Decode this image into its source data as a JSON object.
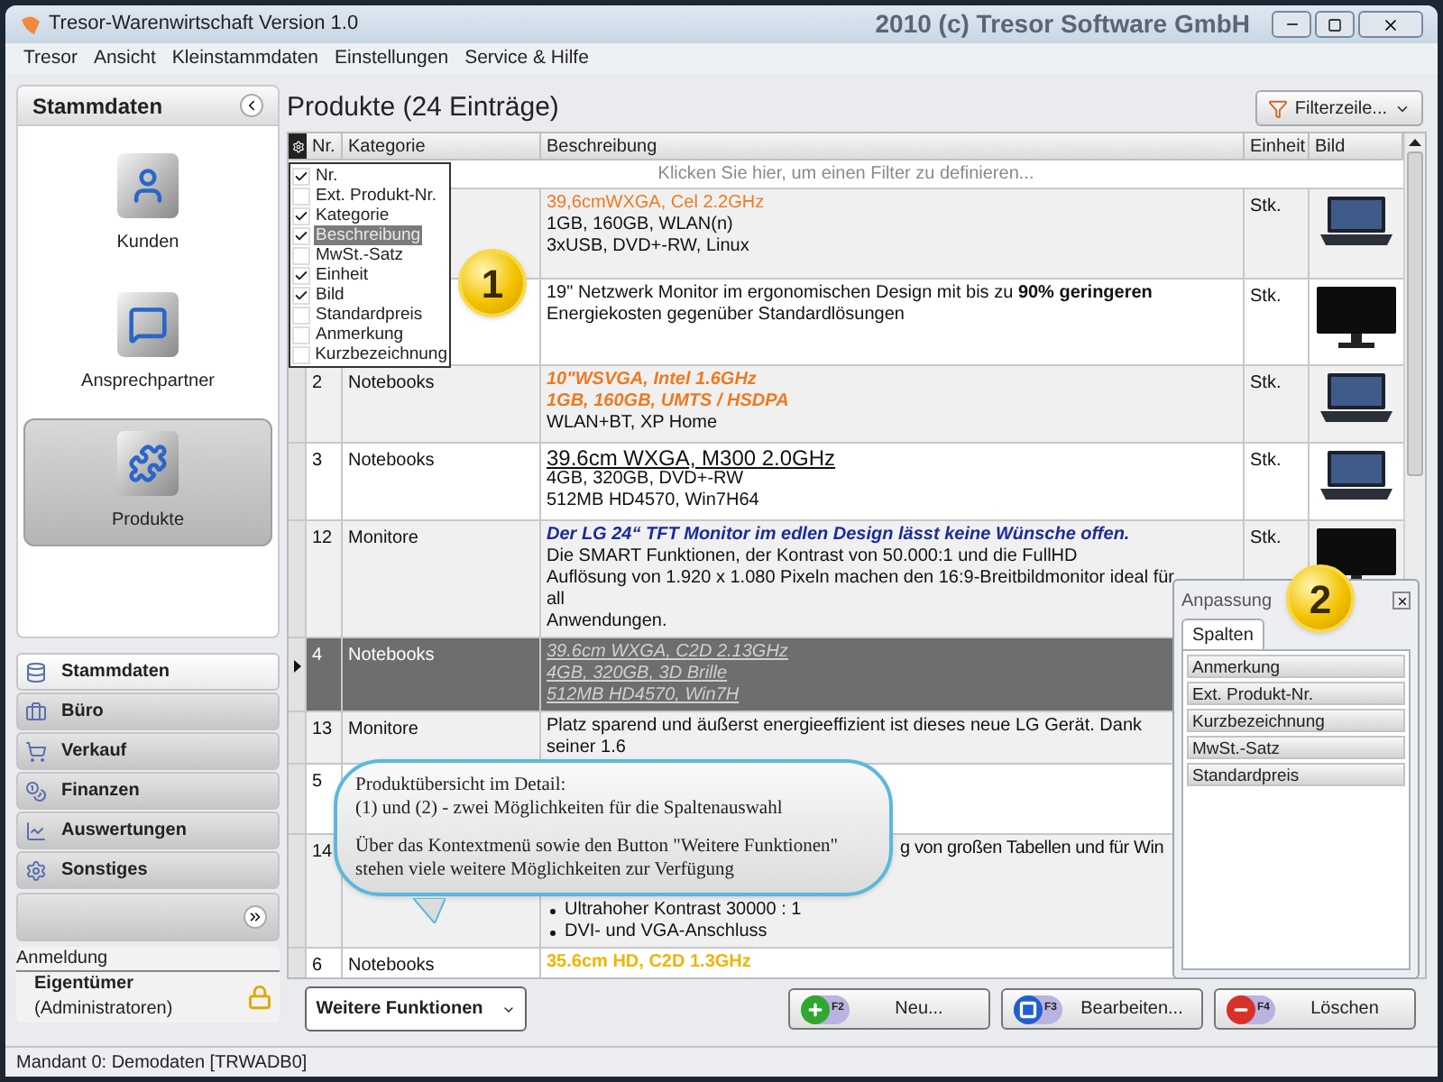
{
  "window": {
    "title": "Tresor-Warenwirtschaft Version 1.0",
    "copyright": "2010 (c) Tresor Software GmbH"
  },
  "menu": [
    "Tresor",
    "Ansicht",
    "Kleinstammdaten",
    "Einstellungen",
    "Service & Hilfe"
  ],
  "sidebar": {
    "title": "Stammdaten",
    "modules": [
      {
        "label": "Kunden",
        "selected": false
      },
      {
        "label": "Ansprechpartner",
        "selected": false
      },
      {
        "label": "Produkte",
        "selected": true
      }
    ],
    "nav": [
      {
        "label": "Stammdaten",
        "selected": true
      },
      {
        "label": "Büro",
        "selected": false
      },
      {
        "label": "Verkauf",
        "selected": false
      },
      {
        "label": "Finanzen",
        "selected": false
      },
      {
        "label": "Auswertungen",
        "selected": false
      },
      {
        "label": "Sonstiges",
        "selected": false
      }
    ],
    "login": {
      "title": "Anmeldung",
      "user": "Eigentümer",
      "group": "(Administratoren)"
    }
  },
  "main": {
    "title": "Produkte (24 Einträge)",
    "filter_button": "Filterzeile...",
    "columns": [
      "Nr.",
      "Kategorie",
      "Beschreibung",
      "Einheit",
      "Bild"
    ],
    "filter_hint": "Klicken Sie hier, um einen Filter zu definieren...",
    "rows": [
      {
        "kind": "laptop",
        "nr": "",
        "category": "",
        "unit": "Stk.",
        "selected": false,
        "lines": [
          {
            "kind": "orange",
            "text": "39,6cmWXGA, Cel 2.2GHz"
          },
          {
            "kind": "plain",
            "text": "1GB, 160GB, WLAN(n)"
          },
          {
            "kind": "plain",
            "text": "3xUSB, DVD+-RW, Linux"
          }
        ]
      },
      {
        "kind": "monitor",
        "nr": "",
        "category": "",
        "unit": "Stk.",
        "selected": false,
        "lines": [
          {
            "kind": "plain",
            "text": "19\" Netzwerk Monitor im ergonomischen Design mit bis zu **90% geringeren** Energiekosten gegenüber Standardlösungen"
          }
        ]
      },
      {
        "kind": "laptop",
        "nr": "2",
        "category": "Notebooks",
        "unit": "Stk.",
        "selected": false,
        "lines": [
          {
            "kind": "orange_italic",
            "text": "10\"WSVGA, Intel 1.6GHz"
          },
          {
            "kind": "orange_italic",
            "text": "1GB, 160GB, UMTS / HSDPA"
          },
          {
            "kind": "plain",
            "text": "WLAN+BT, XP Home"
          }
        ]
      },
      {
        "kind": "laptop",
        "nr": "3",
        "category": "Notebooks",
        "unit": "Stk.",
        "selected": false,
        "lines": [
          {
            "kind": "underline",
            "text": "39.6cm WXGA, M300 2.0GHz"
          },
          {
            "kind": "plain",
            "text": "4GB, 320GB, DVD+-RW"
          },
          {
            "kind": "plain",
            "text": "512MB HD4570, Win7H64"
          }
        ]
      },
      {
        "kind": "monitor",
        "nr": "12",
        "category": "Monitore",
        "unit": "Stk.",
        "selected": false,
        "lines": [
          {
            "kind": "blue_italic",
            "text": "Der LG 24“ TFT Monitor im edlen Design lässt keine Wünsche offen."
          },
          {
            "kind": "plain",
            "text": "Die SMART Funktionen, der Kontrast von 50.000:1 und die FullHD"
          },
          {
            "kind": "plain",
            "text": "Auflösung von 1.920 x 1.080 Pixeln machen den 16:9-Breitbildmonitor ideal für all"
          },
          {
            "kind": "plain",
            "text": "Anwendungen."
          }
        ]
      },
      {
        "kind": "plain",
        "nr": "4",
        "category": "Notebooks",
        "unit": "",
        "selected": true,
        "lines": [
          {
            "kind": "dim_link",
            "text": "39.6cm WXGA, C2D 2.13GHz"
          },
          {
            "kind": "dim_link",
            "text": "4GB, 320GB, 3D Brille"
          },
          {
            "kind": "dim_link",
            "text": "512MB HD4570, Win7H"
          }
        ]
      },
      {
        "kind": "plain",
        "nr": "13",
        "category": "Monitore",
        "unit": "",
        "selected": false,
        "lines": [
          {
            "kind": "plain",
            "text": "Platz sparend und äußerst energieeffizient ist dieses neue LG Gerät. Dank seiner 1.6"
          }
        ]
      },
      {
        "kind": "plain",
        "nr": "5",
        "category": "",
        "unit": "",
        "selected": false,
        "lines": []
      },
      {
        "kind": "plain",
        "nr": "14",
        "category": "",
        "unit": "",
        "selected": false,
        "lines": [
          {
            "kind": "covered",
            "text": "g von großen Tabellen und für Win"
          },
          {
            "kind": "bullet",
            "text": "Ultrahoher Kontrast 30000 : 1"
          },
          {
            "kind": "bullet",
            "text": "DVI- und VGA-Anschluss"
          }
        ]
      },
      {
        "kind": "plain",
        "nr": "6",
        "category": "Notebooks",
        "unit": "",
        "selected": false,
        "lines": [
          {
            "kind": "yellow",
            "text": "35.6cm HD, C2D 1.3GHz"
          }
        ]
      }
    ],
    "column_menu": [
      {
        "label": "Nr.",
        "checked": true,
        "selected": false
      },
      {
        "label": "Ext. Produkt-Nr.",
        "checked": false,
        "selected": false
      },
      {
        "label": "Kategorie",
        "checked": true,
        "selected": false
      },
      {
        "label": "Beschreibung",
        "checked": true,
        "selected": true
      },
      {
        "label": "MwSt.-Satz",
        "checked": false,
        "selected": false
      },
      {
        "label": "Einheit",
        "checked": true,
        "selected": false
      },
      {
        "label": "Bild",
        "checked": true,
        "selected": false
      },
      {
        "label": "Standardpreis",
        "checked": false,
        "selected": false
      },
      {
        "label": "Anmerkung",
        "checked": false,
        "selected": false
      },
      {
        "label": "Kurzbezeichnung",
        "checked": false,
        "selected": false
      }
    ],
    "badges": [
      "1",
      "2"
    ],
    "panel": {
      "title": "Anpassung",
      "tabs": [
        {
          "label": "Spalten",
          "selected": true
        }
      ],
      "items": [
        "Anmerkung",
        "Ext. Produkt-Nr.",
        "Kurzbezeichnung",
        "MwSt.-Satz",
        "Standardpreis"
      ]
    },
    "callout": {
      "paragraphs": [
        [
          "Produktübersicht im Detail:",
          "(1) und (2) - zwei Möglichkeiten für die Spaltenauswahl"
        ],
        [
          "Über das Kontextmenü sowie den Button \"Weitere Funktionen\"",
          "stehen viele weitere Möglichkeiten zur Verfügung"
        ]
      ]
    },
    "more_button": "Weitere Funktionen",
    "actions": [
      {
        "kind": "new",
        "key": "F2",
        "label": "Neu..."
      },
      {
        "kind": "edit",
        "key": "F3",
        "label": "Bearbeiten..."
      },
      {
        "kind": "delete",
        "key": "F4",
        "label": "Löschen"
      }
    ]
  },
  "status_bar": "Mandant 0: Demodaten [TRWADB0]"
}
